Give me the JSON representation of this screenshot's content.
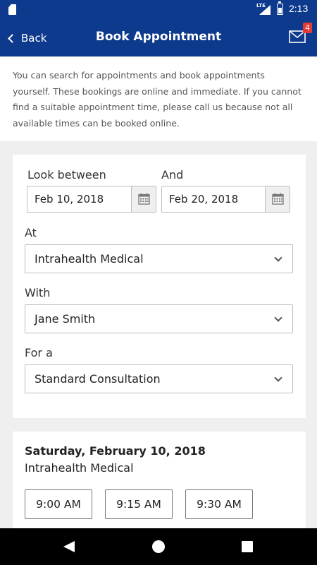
{
  "status_bar": {
    "network": "LTE",
    "time": "2:13"
  },
  "header": {
    "back_label": "Back",
    "title": "Book Appointment",
    "mail_badge": "4"
  },
  "intro_text": "You can search for appointments and book appointments yourself. These bookings are online and immediate. If you cannot find a suitable appointment time, please call us because not all available times can be booked online.",
  "form": {
    "look_between_label": "Look between",
    "start_date": "Feb 10, 2018",
    "and_label": "And",
    "end_date": "Feb 20, 2018",
    "at_label": "At",
    "at_value": "Intrahealth Medical",
    "with_label": "With",
    "with_value": "Jane Smith",
    "for_label": "For a",
    "for_value": "Standard Consultation"
  },
  "results": {
    "date": "Saturday, February 10, 2018",
    "location": "Intrahealth Medical",
    "slots": [
      "9:00 AM",
      "9:15 AM",
      "9:30 AM"
    ]
  },
  "colors": {
    "primary": "#0d3a8c",
    "badge": "#e53935",
    "background": "#efefef"
  },
  "icons": [
    "sd-card-icon",
    "signal-icon",
    "battery-icon",
    "back-chevron-icon",
    "mail-icon",
    "calendar-icon",
    "chevron-down-icon"
  ]
}
